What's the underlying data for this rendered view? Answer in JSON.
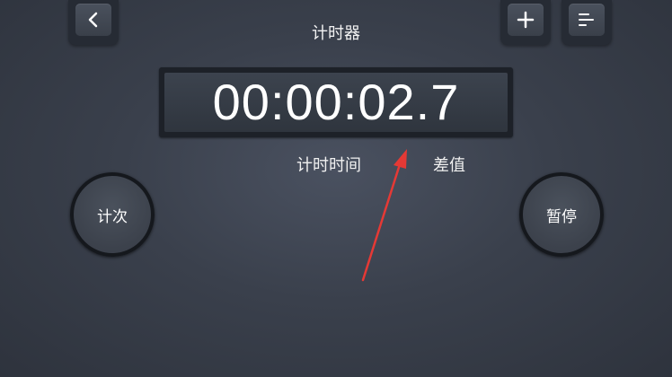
{
  "header": {
    "title": "计时器",
    "back_icon": "chevron-left-icon",
    "add_icon": "plus-icon",
    "menu_icon": "list-icon"
  },
  "display": {
    "time": "00:00:02.7"
  },
  "labels": {
    "elapsed": "计时时间",
    "difference": "差值"
  },
  "buttons": {
    "lap": "计次",
    "pause": "暂停"
  },
  "colors": {
    "annotation_arrow": "#e53935"
  }
}
